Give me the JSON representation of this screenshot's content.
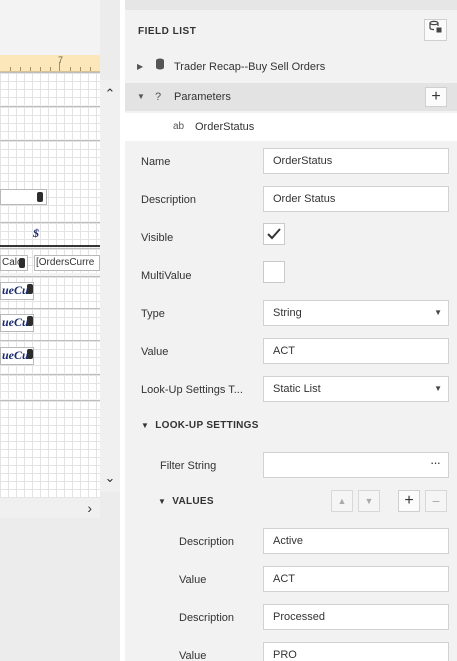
{
  "designer": {
    "ruler_mark": "7",
    "cells": {
      "calc": "Calc",
      "orders_current": "[OrdersCurre",
      "dollar": "$",
      "expr1": "ueCu",
      "expr2": "ueCu",
      "expr3": "ueCu"
    }
  },
  "field_list": {
    "title": "FIELD LIST",
    "tree": {
      "datasource": "Trader Recap--Buy Sell Orders",
      "parameters": "Parameters",
      "parameter_item": "OrderStatus",
      "parameter_item_icon_text": "ab"
    },
    "properties": {
      "name_label": "Name",
      "name_value": "OrderStatus",
      "description_label": "Description",
      "description_value": "Order Status",
      "visible_label": "Visible",
      "visible_checked": true,
      "multivalue_label": "MultiValue",
      "multivalue_checked": false,
      "type_label": "Type",
      "type_value": "String",
      "value_label": "Value",
      "value_value": "ACT",
      "lookup_label": "Look-Up Settings T...",
      "lookup_value": "Static List"
    },
    "lookup_settings": {
      "section_title": "LOOK-UP SETTINGS",
      "filter_label": "Filter String",
      "filter_value": "",
      "filter_button": "···",
      "values_title": "VALUES",
      "items": [
        {
          "description_label": "Description",
          "description_value": "Active",
          "value_label": "Value",
          "value_value": "ACT"
        },
        {
          "description_label": "Description",
          "description_value": "Processed",
          "value_label": "Value",
          "value_value": "PRO"
        }
      ]
    }
  }
}
